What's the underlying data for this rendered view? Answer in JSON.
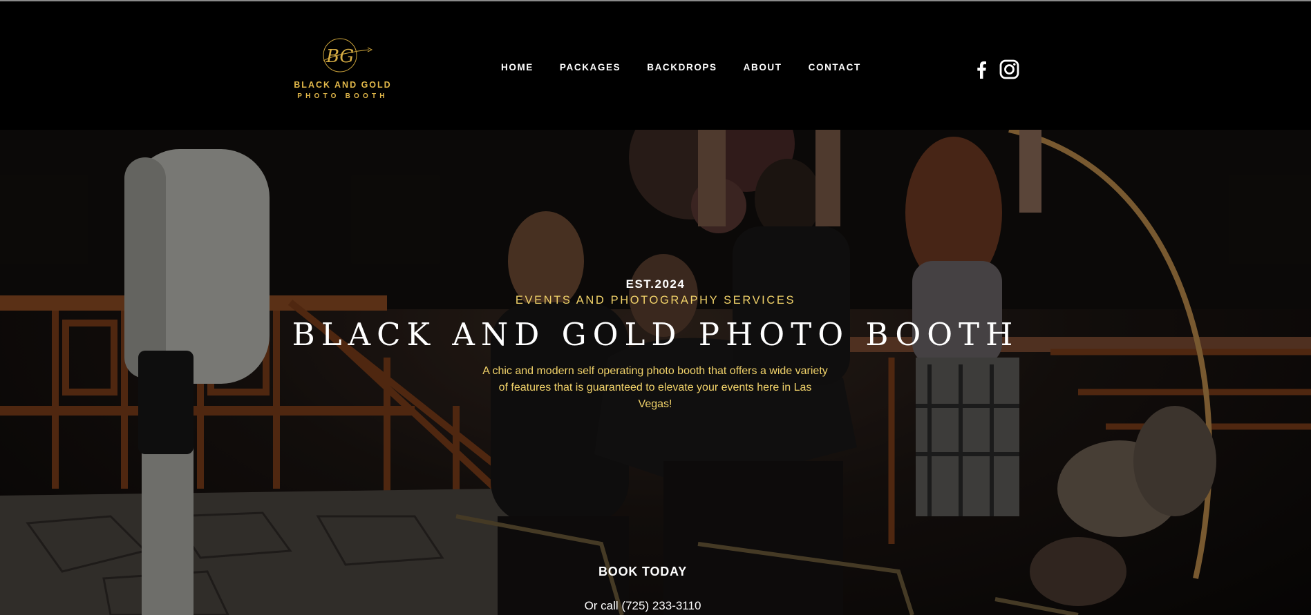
{
  "brand": {
    "monogram": "BG",
    "name_line1": "BLACK AND GOLD",
    "name_line2": "PHOTO BOOTH",
    "accent_color": "#e2b84a"
  },
  "nav": {
    "items": [
      {
        "label": "HOME"
      },
      {
        "label": "PACKAGES"
      },
      {
        "label": "BACKDROPS"
      },
      {
        "label": "ABOUT"
      },
      {
        "label": "CONTACT"
      }
    ]
  },
  "social": {
    "icons": [
      "facebook-icon",
      "instagram-icon"
    ]
  },
  "hero": {
    "established": "EST.2024",
    "services": "EVENTS AND PHOTOGRAPHY SERVICES",
    "title": "BLACK AND GOLD PHOTO BOOTH",
    "tagline": "A chic and modern self operating photo booth that offers a wide variety of features that is guaranteed to elevate your events here in Las Vegas!",
    "cta_label": "BOOK TODAY",
    "phone_text": "Or call (725) 233-3110",
    "text_gold": "#f2d36a"
  }
}
